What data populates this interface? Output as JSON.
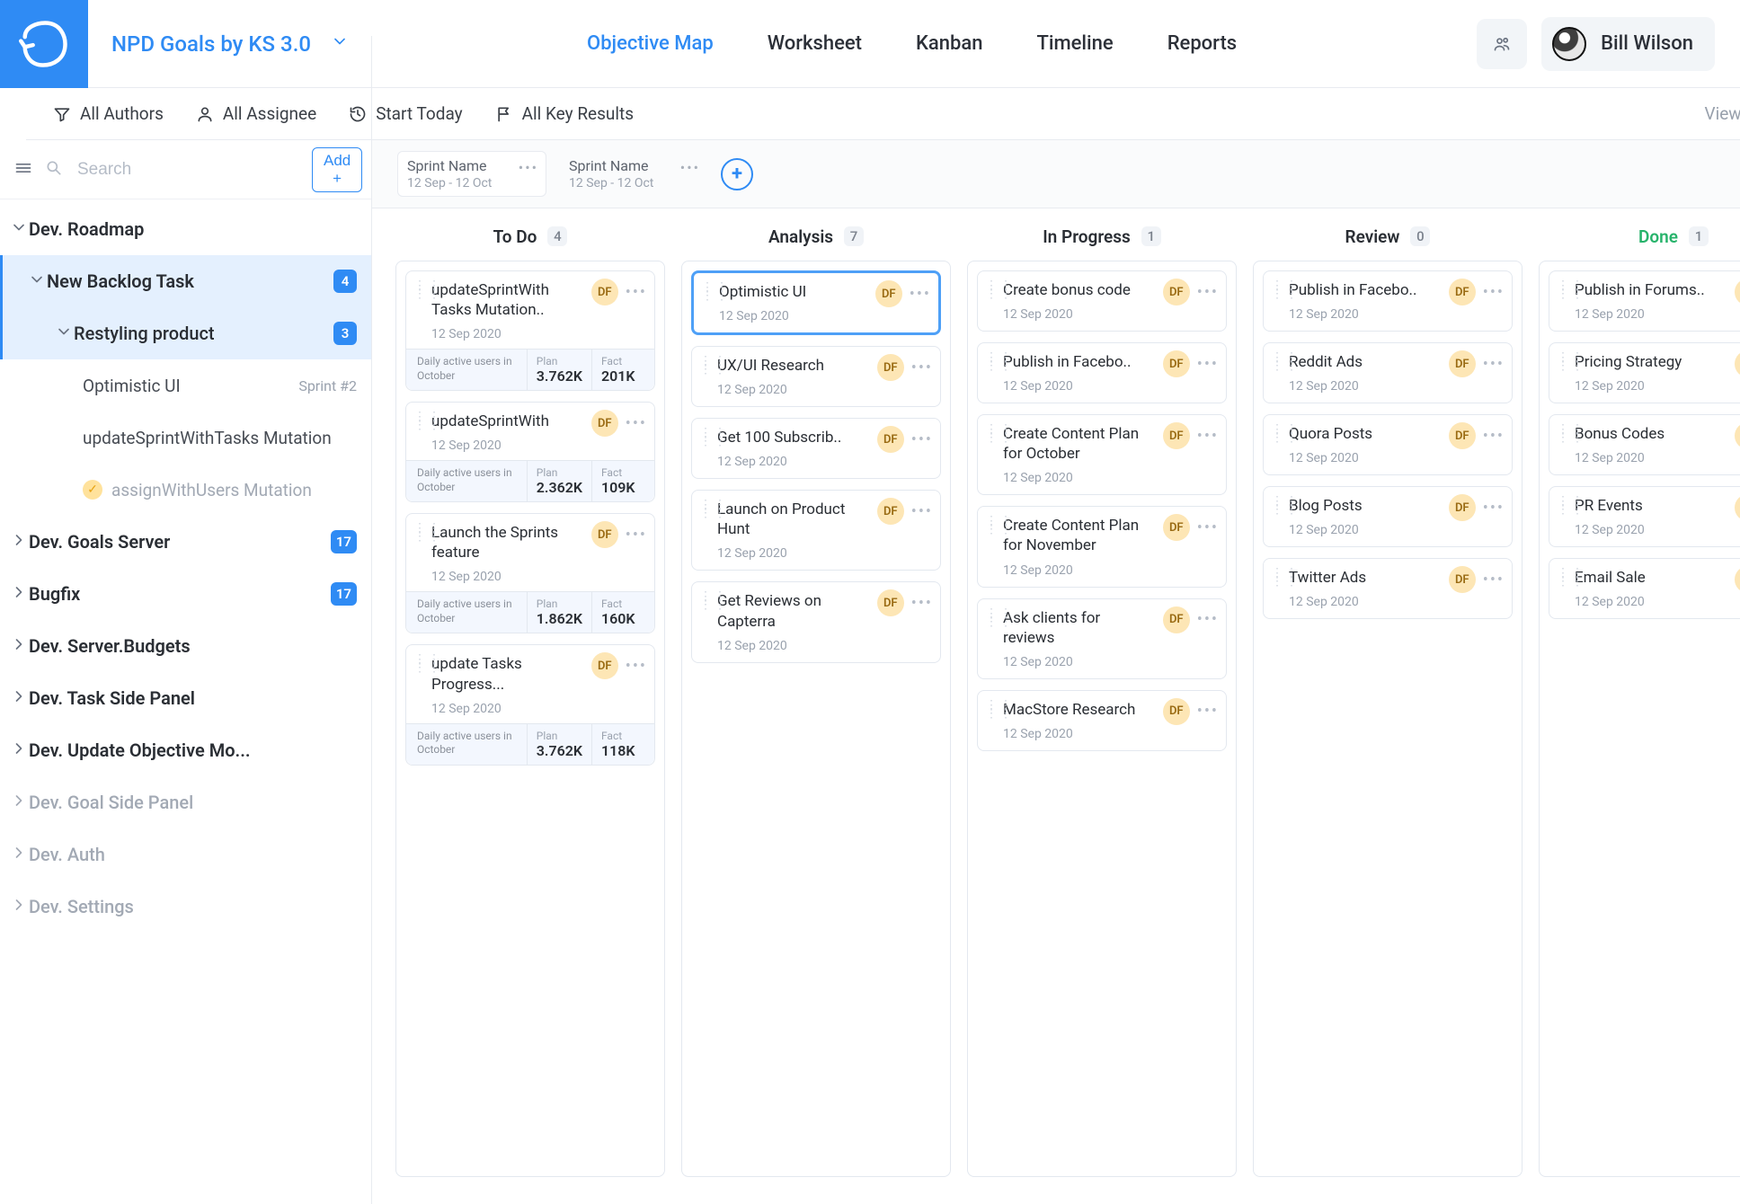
{
  "header": {
    "workspace_title": "NPD Goals by KS 3.0",
    "tabs": [
      "Objective Map",
      "Worksheet",
      "Kanban",
      "Timeline",
      "Reports"
    ],
    "active_tab_index": 0,
    "user_name": "Bill Wilson"
  },
  "filter_bar": {
    "authors_label": "All Authors",
    "assignee_label": "All Assignee",
    "start_today_label": "Start Today",
    "key_results_label": "All Key Results",
    "view_options_label": "View Options"
  },
  "sidebar": {
    "search_placeholder": "Search",
    "add_button_label": "Add +",
    "tree": [
      {
        "id": "roadmap",
        "level": 0,
        "label": "Dev. Roadmap",
        "open": true
      },
      {
        "id": "backlog",
        "level": 1,
        "label": "New Backlog Task",
        "open": true,
        "badge": "4",
        "selected": true
      },
      {
        "id": "restyle",
        "level": 2,
        "label": "Restyling product",
        "open": true,
        "badge": "3",
        "selected": true
      },
      {
        "id": "optui",
        "level": 3,
        "label": "Optimistic UI",
        "meta": "Sprint #2"
      },
      {
        "id": "uswt",
        "level": 3,
        "label": "updateSprintWithTasks Mutation"
      },
      {
        "id": "assign",
        "level": 3,
        "label": "assignWithUsers Mutation",
        "done": true
      },
      {
        "id": "goalsrv",
        "level": 0,
        "label": "Dev. Goals Server",
        "badge": "17"
      },
      {
        "id": "bugfix",
        "level": 0,
        "label": "Bugfix",
        "badge": "17"
      },
      {
        "id": "budgets",
        "level": 0,
        "label": "Dev. Server.Budgets"
      },
      {
        "id": "tsp",
        "level": 0,
        "label": "Dev. Task Side Panel"
      },
      {
        "id": "uom",
        "level": 0,
        "label": "Dev. Update Objective Mo..."
      },
      {
        "id": "gsp",
        "level": 0,
        "label": "Dev. Goal Side Panel",
        "faded": true
      },
      {
        "id": "auth",
        "level": 0,
        "label": "Dev. Auth",
        "faded": true
      },
      {
        "id": "settings",
        "level": 0,
        "label": "Dev. Settings",
        "faded": true
      }
    ]
  },
  "sprints": [
    {
      "name": "Sprint Name",
      "range": "12 Sep - 12 Oct",
      "boxed": true
    },
    {
      "name": "Sprint Name",
      "range": "12 Sep - 12 Oct",
      "boxed": false
    }
  ],
  "card_defaults": {
    "assignee_initials": "DF",
    "metric_label": "Daily active users in October",
    "plan_label": "Plan",
    "fact_label": "Fact"
  },
  "board": {
    "columns": [
      {
        "id": "todo",
        "title": "To Do",
        "count": "4",
        "cards": [
          {
            "title": "updateSprintWith Tasks Mutation..",
            "date": "12 Sep 2020",
            "metric": {
              "plan": "3.762K",
              "fact": "201K"
            }
          },
          {
            "title": "updateSprintWith",
            "date": "12 Sep 2020",
            "metric": {
              "plan": "2.362K",
              "fact": "109K"
            }
          },
          {
            "title": "Launch the Sprints feature",
            "date": "12 Sep 2020",
            "metric": {
              "plan": "1.862K",
              "fact": "160K"
            }
          },
          {
            "title": "update Tasks Progress...",
            "date": "12 Sep 2020",
            "metric": {
              "plan": "3.762K",
              "fact": "118K"
            }
          }
        ]
      },
      {
        "id": "analysis",
        "title": "Analysis",
        "count": "7",
        "cards": [
          {
            "title": "Optimistic UI",
            "date": "12 Sep 2020",
            "selected": true
          },
          {
            "title": "UX/UI Research",
            "date": "12 Sep 2020"
          },
          {
            "title": "Get 100 Subscrib..",
            "date": "12 Sep 2020"
          },
          {
            "title": "Launch on Product Hunt",
            "date": "12 Sep 2020"
          },
          {
            "title": "Get Reviews on Capterra",
            "date": "12 Sep 2020"
          }
        ]
      },
      {
        "id": "inprogress",
        "title": "In Progress",
        "count": "1",
        "cards": [
          {
            "title": "Create bonus code",
            "date": "12 Sep 2020"
          },
          {
            "title": "Publish in Facebo..",
            "date": "12 Sep 2020"
          },
          {
            "title": "Create Content Plan for October",
            "date": "12 Sep 2020"
          },
          {
            "title": "Create Content Plan for November",
            "date": "12 Sep 2020"
          },
          {
            "title": "Ask clients for reviews",
            "date": "12 Sep 2020"
          },
          {
            "title": "MacStore Research",
            "date": "12 Sep 2020"
          }
        ]
      },
      {
        "id": "review",
        "title": "Review",
        "count": "0",
        "cards": [
          {
            "title": "Publish in Facebo..",
            "date": "12 Sep 2020"
          },
          {
            "title": "Reddit Ads",
            "date": "12 Sep 2020"
          },
          {
            "title": "Quora Posts",
            "date": "12 Sep 2020"
          },
          {
            "title": "Blog Posts",
            "date": "12 Sep 2020"
          },
          {
            "title": "Twitter Ads",
            "date": "12 Sep 2020"
          }
        ]
      },
      {
        "id": "done",
        "title": "Done",
        "count": "1",
        "done_style": true,
        "cards": [
          {
            "title": "Publish in Forums..",
            "date": "12 Sep 2020"
          },
          {
            "title": "Pricing Strategy",
            "date": "12 Sep 2020"
          },
          {
            "title": "Bonus Codes",
            "date": "12 Sep 2020"
          },
          {
            "title": "PR Events",
            "date": "12 Sep 2020"
          },
          {
            "title": "Email Sale",
            "date": "12 Sep 2020"
          }
        ]
      }
    ]
  }
}
